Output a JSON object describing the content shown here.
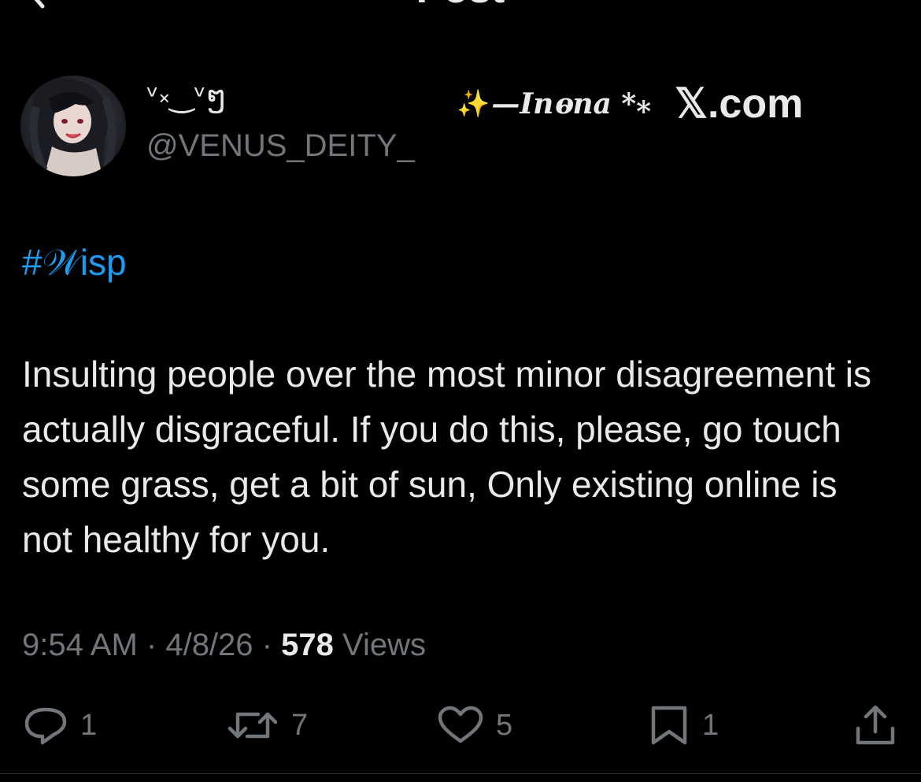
{
  "header": {
    "title": "Post"
  },
  "author": {
    "display_name": "ᵛ༝‿ᵛໆ",
    "handle": "@VENUS_DEITY_"
  },
  "watermark": {
    "sparkle": "✨",
    "name": "—Inⱺna *⁎",
    "site": "𝕏.com"
  },
  "post": {
    "hashtag": "#𝒲isp",
    "text": "Insulting people over the most minor disagreement is actually disgraceful. If you do this, please, go touch some grass, get a bit of sun, Only existing online is not healthy for you.",
    "time": "9:54 AM",
    "date": "4/8/26",
    "views_count": "578",
    "views_label": "Views"
  },
  "actions": {
    "replies": "1",
    "reposts": "7",
    "likes": "5",
    "bookmarks": "1"
  },
  "colors": {
    "background": "#000000",
    "text": "#e7e9ea",
    "secondary": "#71767b",
    "link": "#1d9bf0"
  },
  "icons": [
    "back-arrow-icon",
    "reply-icon",
    "repost-icon",
    "like-icon",
    "bookmark-icon",
    "share-icon"
  ]
}
